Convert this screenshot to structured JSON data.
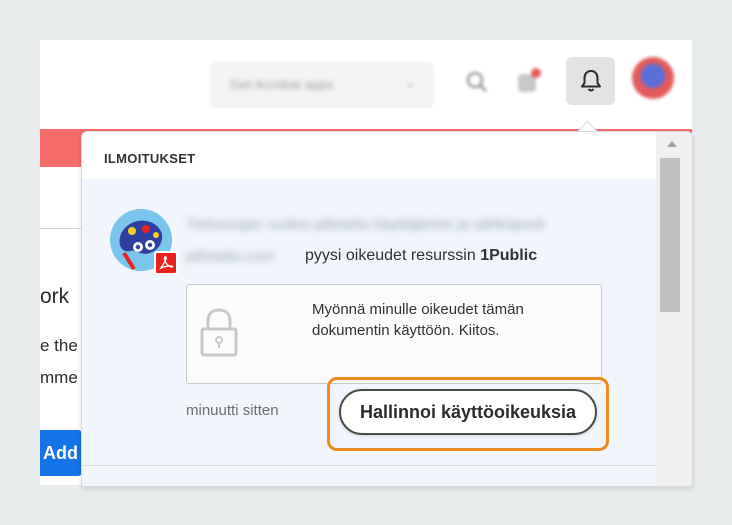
{
  "topbar": {
    "switcher_label": "Get Acrobat apps",
    "icons": [
      "search-icon",
      "apps-icon",
      "bell-icon",
      "avatar"
    ]
  },
  "background_page": {
    "heading_fragment": "ork",
    "line1_fragment": "e the",
    "line2_fragment": "mme",
    "button_fragment": "Add"
  },
  "notifications": {
    "title": "ILMOITUKSET",
    "item": {
      "sender_blurred_line1": "Tietosuojan vuoksi piilotettu käyttäjänimi ja sähköposti",
      "sender_blurred_line2": "piilotettu.com",
      "action_text": "pyysi oikeudet resurssin ",
      "resource": "1Public",
      "message": "Myönnä minulle oikeudet tämän dokumentin käyttöön. Kiitos.",
      "time": "minuutti sitten",
      "manage_button": "Hallinnoi käyttöoikeuksia"
    }
  },
  "colors": {
    "highlight": "#ee8c1f",
    "red_banner": "#f76b6b",
    "accent_blue": "#1473e6",
    "pdf_red": "#e8231d"
  }
}
